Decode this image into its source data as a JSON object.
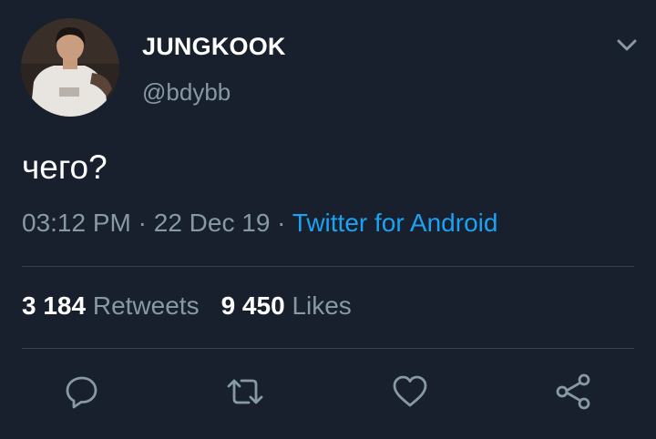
{
  "author": {
    "display_name": "JUNGKOOK",
    "handle": "@bdybb",
    "avatar_icon": "profile-photo"
  },
  "tweet": {
    "text": "чего?",
    "time": "03:12 PM",
    "date": "22 Dec 19",
    "separator": "·",
    "source": "Twitter for Android"
  },
  "stats": {
    "retweets_count": "3 184",
    "retweets_label": "Retweets",
    "likes_count": "9 450",
    "likes_label": "Likes"
  },
  "actions": {
    "reply_icon": "reply-icon",
    "retweet_icon": "retweet-icon",
    "like_icon": "heart-icon",
    "share_icon": "share-icon"
  },
  "colors": {
    "background": "#17202c",
    "secondary_text": "#8899a6",
    "accent": "#1da1f2",
    "divider": "#38444d"
  }
}
